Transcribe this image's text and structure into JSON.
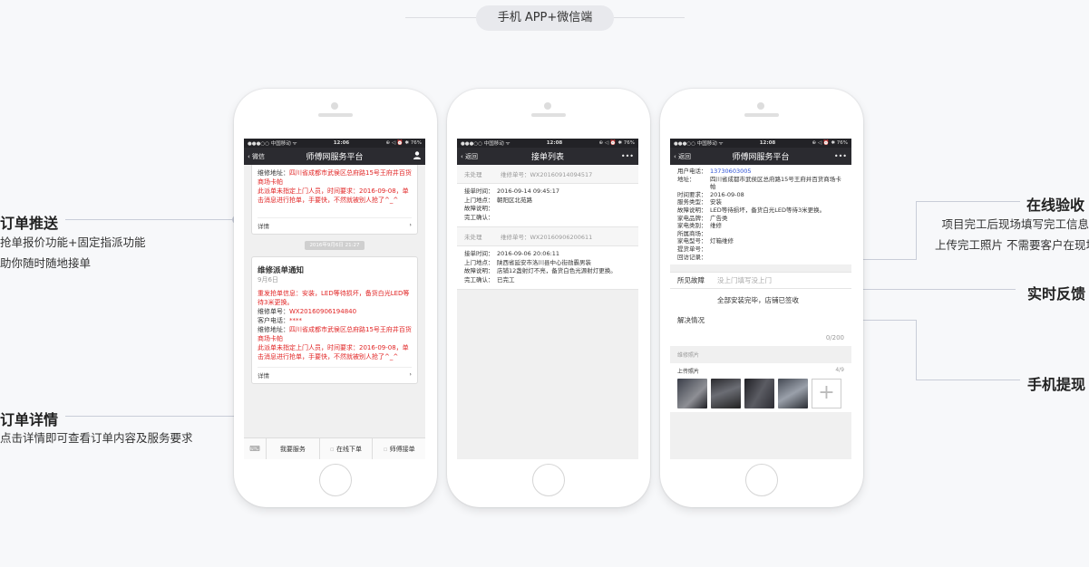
{
  "header": {
    "title": "手机 APP+微信端"
  },
  "annotations": {
    "order_push": {
      "title": "订单推送",
      "lines": [
        "抢单报价功能+固定指派功能",
        "助你随时随地接单"
      ]
    },
    "order_detail": {
      "title": "订单详情",
      "lines": [
        "点击详情即可查看订单内容及服务要求"
      ]
    },
    "online_accept": {
      "title": "在线验收",
      "lines": [
        "项目完工后现场填写完工信息",
        "上传完工照片 不需要客户在现场"
      ]
    },
    "realtime": {
      "title": "实时反馈"
    },
    "mobile_withdraw": {
      "title": "手机提现"
    }
  },
  "phone1": {
    "status": {
      "carrier": "●●●○○ 中国移动 ᯤ",
      "time": "12:06",
      "battery": "⊕ ◁ ⏰ ✱ 76%"
    },
    "nav": {
      "back": "微信",
      "title": "师傅网服务平台"
    },
    "card1": {
      "address_label": "维修地址：",
      "address": "四川省成都市武侯区总府路15号王府井百货商场卡帕",
      "notice": "此派单未指定上门人员，时间要求：2016-09-08，单击消息进行抢单，手要快，不然就被别人抢了^_^",
      "detail": "详情"
    },
    "timestamp": "2016年9月6日 21:27",
    "card2": {
      "title": "维修派单通知",
      "date": "9月6日",
      "info": "重发抢单信息：安装，LED等待损坏，备货白光LED等待3米更换。",
      "order_label": "维修单号：",
      "order_no": "WX20160906194840",
      "phone_label": "客户电话：",
      "phone": "****",
      "address_label": "维修地址：",
      "address": "四川省成都市武侯区总府路15号王府井百货商场卡帕",
      "notice": "此派单未指定上门人员，时间要求：2016-09-08，单击消息进行抢单，手要快，不然就被别人抢了^_^",
      "detail": "详情"
    },
    "tabs": [
      "⌨",
      "我要服务",
      "在线下单",
      "师傅接单"
    ]
  },
  "phone2": {
    "status": {
      "carrier": "●●●○○ 中国移动 ᯤ",
      "time": "12:08",
      "battery": "⊕ ◁ ⏰ ✱ 76%"
    },
    "nav": {
      "back": "返回",
      "title": "接单列表",
      "more": "•••"
    },
    "orders": [
      {
        "state": "未处理",
        "order_no": "维修单号：WX20160914094517",
        "fields": [
          {
            "k": "接单时间：",
            "v": "2016-09-14 09:45:17"
          },
          {
            "k": "上门地点：",
            "v": "朝阳区北苑路"
          },
          {
            "k": "故障说明：",
            "v": ""
          },
          {
            "k": "完工确认：",
            "v": ""
          }
        ]
      },
      {
        "state": "未处理",
        "order_no": "维修单号：WX20160906200611",
        "fields": [
          {
            "k": "接单时间：",
            "v": "2016-09-06 20:06:11"
          },
          {
            "k": "上门地点：",
            "v": "陕西省延安市洛川县中心街勋霸男装"
          },
          {
            "k": "故障说明：",
            "v": "店铺12盏射灯不亮，备货白色光源射灯更换。"
          },
          {
            "k": "完工确认：",
            "v": "已完工"
          }
        ]
      }
    ]
  },
  "phone3": {
    "status": {
      "carrier": "●●●○○ 中国移动 ᯤ",
      "time": "12:08",
      "battery": "⊕ ◁ ⏰ ✱ 76%"
    },
    "nav": {
      "back": "返回",
      "title": "师傅网服务平台",
      "more": "•••"
    },
    "info": [
      {
        "k": "用户电话：",
        "v": "13730603005",
        "link": true
      },
      {
        "k": "地址：",
        "v": "四川省成都市武侯区总府路15号王府井百货商场卡帕"
      },
      {
        "k": "时间要求：",
        "v": "2016-09-08"
      },
      {
        "k": "服务类型：",
        "v": "安装"
      },
      {
        "k": "故障说明：",
        "v": "LED等待损坏，备货白光LED等待3米更换。"
      },
      {
        "k": "家电品牌：",
        "v": "广告类"
      },
      {
        "k": "家电类别：",
        "v": "维修"
      },
      {
        "k": "所属商场：",
        "v": ""
      },
      {
        "k": "家电型号：",
        "v": "灯箱维修"
      },
      {
        "k": "提货单号：",
        "v": ""
      },
      {
        "k": "回访记录：",
        "v": ""
      }
    ],
    "fault_label": "所见故障",
    "fault_placeholder": "没上门填写没上门",
    "resolution_text": "全部安装完毕，店铺已签收",
    "resolution_label": "解决情况",
    "counter": "0/200",
    "photos_label": "维修照片",
    "upload_label": "上传照片",
    "upload_count": "4/9",
    "plus": "+"
  }
}
